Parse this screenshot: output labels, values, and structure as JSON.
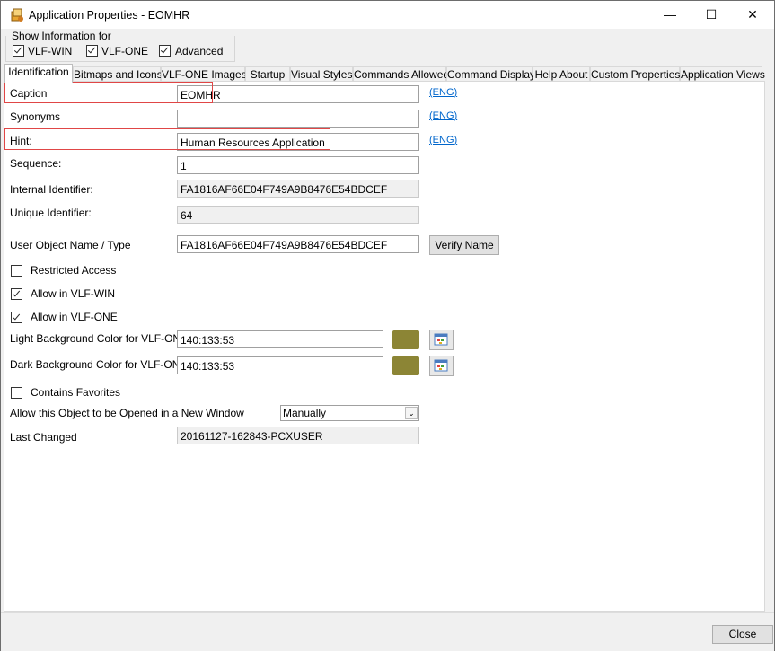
{
  "window": {
    "title": "Application Properties - EOMHR",
    "minimize_glyph": "—",
    "maximize_glyph": "☐",
    "close_glyph": "✕"
  },
  "show_info": {
    "legend": "Show Information for",
    "options": [
      {
        "label": "VLF-WIN",
        "checked": true
      },
      {
        "label": "VLF-ONE",
        "checked": true
      },
      {
        "label": "Advanced",
        "checked": true
      }
    ]
  },
  "tabs": [
    "Identification",
    "Bitmaps and Icons",
    "VLF-ONE Images",
    "Startup",
    "Visual Styles",
    "Commands Allowed",
    "Command Display",
    "Help About",
    "Custom Properties",
    "Application Views"
  ],
  "active_tab": "Identification",
  "form": {
    "caption_label": "Caption",
    "caption_value": "EOMHR",
    "caption_link": "(ENG)",
    "synonyms_label": "Synonyms",
    "synonyms_value": "",
    "synonyms_link": "(ENG)",
    "hint_label": "Hint:",
    "hint_value": "Human Resources Application",
    "hint_link": "(ENG)",
    "sequence_label": "Sequence:",
    "sequence_value": "1",
    "internal_id_label": "Internal Identifier:",
    "internal_id_value": "FA1816AF66E04F749A9B8476E54BDCEF",
    "unique_id_label": "Unique Identifier:",
    "unique_id_value": "64",
    "user_object_label": "User Object Name / Type",
    "user_object_value": "FA1816AF66E04F749A9B8476E54BDCEF",
    "verify_button": "Verify Name",
    "restricted_access_label": "Restricted Access",
    "restricted_access_checked": false,
    "allow_vlfwin_label": "Allow in VLF-WIN",
    "allow_vlfwin_checked": true,
    "allow_vlfone_label": "Allow in VLF-ONE",
    "allow_vlfone_checked": true,
    "light_bg_label": "Light Background Color for VLF-ONE",
    "light_bg_value": "140:133:53",
    "dark_bg_label": "Dark Background Color for VLF-ONE",
    "dark_bg_value": "140:133:53",
    "swatch_color": "#8c8535",
    "contains_favorites_label": "Contains Favorites",
    "contains_favorites_checked": false,
    "open_new_window_label": "Allow this Object to be Opened in a New Window",
    "open_new_window_value": "Manually",
    "last_changed_label": "Last Changed",
    "last_changed_value": "20161127-162843-PCXUSER"
  },
  "footer": {
    "close_button": "Close"
  },
  "colors": {
    "highlight": "#e04646",
    "link": "#0066cc"
  }
}
